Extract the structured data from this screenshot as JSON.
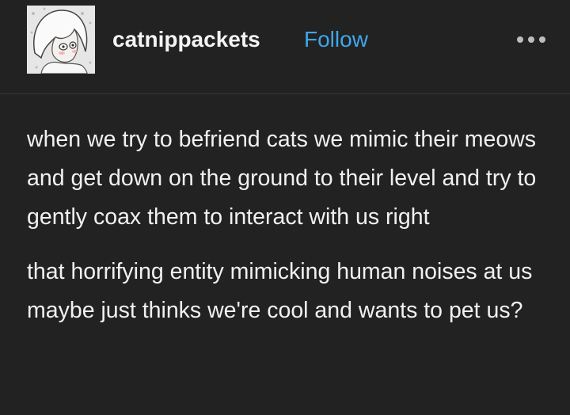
{
  "post": {
    "author": {
      "username": "catnippackets",
      "follow_label": "Follow",
      "avatar_icon": "avatar-image"
    },
    "more_icon": "ellipsis-icon",
    "paragraphs": [
      "when we try to befriend cats we mimic their meows and get down on the ground to their level and try to gently coax them to interact with us right",
      "that horrifying entity mimicking human noises at us maybe just thinks we're cool and wants to pet us?"
    ]
  },
  "colors": {
    "background": "#222222",
    "text": "#f1f1f1",
    "accent": "#3fa7ea"
  }
}
